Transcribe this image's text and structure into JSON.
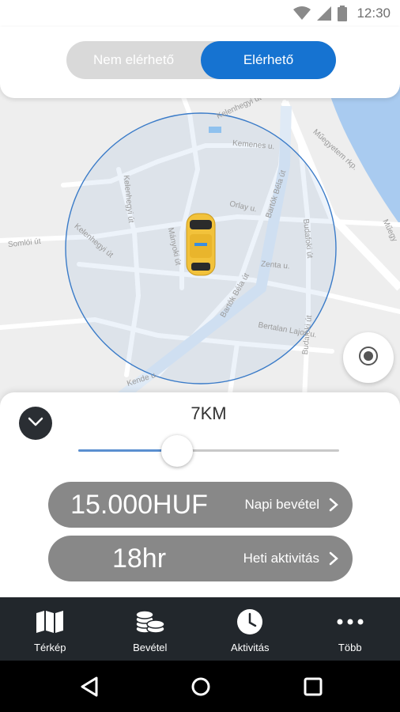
{
  "status_bar": {
    "time": "12:30"
  },
  "availability_toggle": {
    "off_label": "Nem elérhető",
    "on_label": "Elérhető",
    "active": "on",
    "active_color": "#1673d1"
  },
  "map": {
    "streets": [
      "Kelenhegyi út",
      "Kemenes u.",
      "Műegyetem rkp.",
      "Orlay u.",
      "Bartók Béla út",
      "Kelenhegyi út",
      "Somlói út",
      "Mányoki út",
      "Budafoki út",
      "Zenta u.",
      "Bertalan Lajos u.",
      "Bartók Béla út",
      "Budafoki út",
      "Műegy",
      "Kelenhegyi út",
      "Kende u."
    ],
    "radius_circle_color": "#3a7bc8"
  },
  "sheet": {
    "radius_value": "7KM",
    "slider_value_fraction": 0.38,
    "stats": [
      {
        "value": "15.000HUF",
        "label": "Napi bevétel"
      },
      {
        "value": "18hr",
        "label": "Heti aktivitás"
      }
    ]
  },
  "bottom_nav": [
    {
      "label": "Térkép",
      "icon": "map-icon"
    },
    {
      "label": "Bevétel",
      "icon": "coins-icon"
    },
    {
      "label": "Aktivitás",
      "icon": "clock-icon"
    },
    {
      "label": "Több",
      "icon": "more-icon"
    }
  ],
  "system_nav": {
    "icons": [
      "back-icon",
      "home-icon",
      "recents-icon"
    ]
  }
}
